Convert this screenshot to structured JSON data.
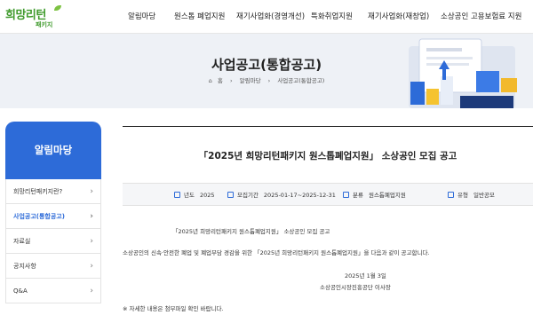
{
  "header": {
    "logo_main": "희망리턴",
    "logo_sub": "패키지",
    "nav": [
      "알림마당",
      "원스톱 폐업지원",
      "재기사업화(경영개선)",
      "특화취업지원",
      "재기사업화(재창업)",
      "소상공인 고용보험료 지원"
    ]
  },
  "banner": {
    "title": "사업공고(통합공고)",
    "breadcrumb": [
      "홈",
      "알림마당",
      "사업공고(통합공고)"
    ]
  },
  "sidebar": {
    "title": "알림마당",
    "items": [
      {
        "label": "희망리턴패키지란?"
      },
      {
        "label": "사업공고(통합공고)"
      },
      {
        "label": "자료실"
      },
      {
        "label": "공지사항"
      },
      {
        "label": "Q&A"
      }
    ]
  },
  "post": {
    "title": "「2025년 희망리턴패키지 원스톱폐업지원」 소상공인 모집 공고",
    "meta": {
      "year_label": "년도",
      "year_value": "2025",
      "period_label": "모집기간",
      "period_value": "2025-01-17~2025-12-31",
      "category_label": "분류",
      "category_value": "원스톱폐업지원",
      "type_label": "유형",
      "type_value": "일반공모"
    },
    "body": {
      "heading": "「2025년 희망리턴패키지 원스톱폐업지원」 소상공인 모집 공고",
      "paragraph": "소상공인의 신속·안전한 폐업 및 폐업부담 경감을 위한 「2025년 희망리턴패키지 원스톱폐업지원」을 다음과 같이 공고합니다.",
      "date": "2025년 1월 3일",
      "issuer": "소상공인시장진흥공단 이사장",
      "note": "※ 자세한 내용은 첨부파일 확인 바랍니다."
    }
  },
  "colors": {
    "brand_green": "#3f9a2c",
    "accent_blue": "#2d6bd8",
    "banner_bg": "#eef1f6"
  }
}
